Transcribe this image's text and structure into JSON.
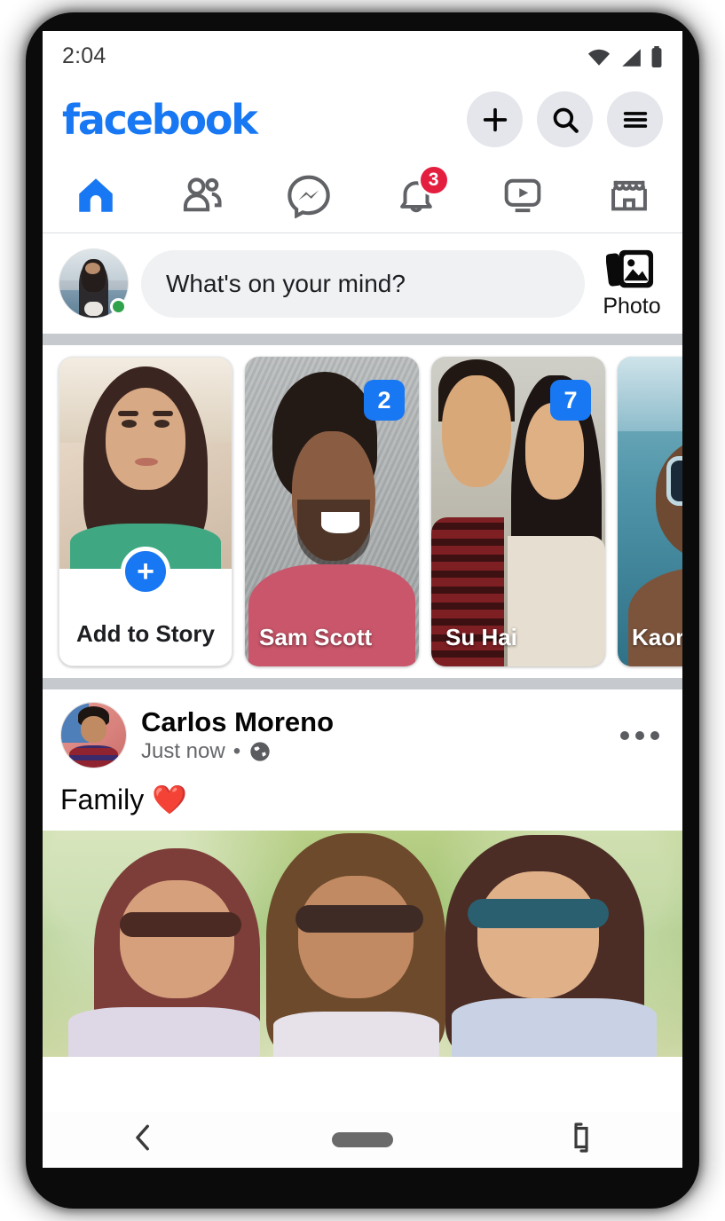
{
  "status_bar": {
    "time": "2:04",
    "icons": [
      "wifi-icon",
      "cellular-signal-icon",
      "battery-icon"
    ]
  },
  "app_bar": {
    "logo_text": "facebook",
    "logo_color": "#1877F2",
    "buttons": [
      {
        "name": "create-button",
        "icon": "plus-icon"
      },
      {
        "name": "search-button",
        "icon": "search-icon"
      },
      {
        "name": "menu-button",
        "icon": "hamburger-menu-icon"
      }
    ]
  },
  "nav_tabs": [
    {
      "name": "home",
      "icon": "home-icon",
      "active": true,
      "badge": ""
    },
    {
      "name": "friends",
      "icon": "friends-icon",
      "active": false,
      "badge": ""
    },
    {
      "name": "messenger",
      "icon": "messenger-icon",
      "active": false,
      "badge": ""
    },
    {
      "name": "notifications",
      "icon": "bell-icon",
      "active": false,
      "badge": "3"
    },
    {
      "name": "video",
      "icon": "video-icon",
      "active": false,
      "badge": ""
    },
    {
      "name": "marketplace",
      "icon": "marketplace-icon",
      "active": false,
      "badge": ""
    }
  ],
  "composer": {
    "placeholder": "What's on your mind?",
    "photo_label": "Photo",
    "avatar_alt": "user-profile-photo",
    "online": true
  },
  "stories": [
    {
      "type": "add",
      "label": "Add to Story",
      "badge": ""
    },
    {
      "type": "story",
      "label": "Sam Scott",
      "badge": "2"
    },
    {
      "type": "story",
      "label": "Su Hai",
      "badge": "7"
    },
    {
      "type": "story",
      "label": "Kaori Wata",
      "badge": ""
    }
  ],
  "post": {
    "author": "Carlos Moreno",
    "timestamp": "Just now",
    "separator": "•",
    "privacy_icon": "globe-icon",
    "menu_icon": "more-options-icon",
    "text": "Family ❤️",
    "image_alt": "three-women-wearing-sunglasses-outdoors"
  },
  "system_nav": {
    "back": "back-chevron-icon",
    "home": "home-pill-icon",
    "rotate": "rotate-screen-icon"
  },
  "colors": {
    "brand_blue": "#1877F2",
    "badge_red": "#E41E3F",
    "online_green": "#31A24C",
    "chip_gray": "#E4E6EB",
    "divider_gray": "#C6C9CE",
    "text_secondary": "#65676B"
  }
}
